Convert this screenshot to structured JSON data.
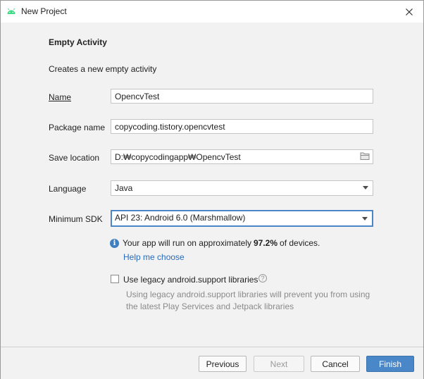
{
  "window": {
    "title": "New Project"
  },
  "content": {
    "heading": "Empty Activity",
    "description": "Creates a new empty activity",
    "fields": {
      "name": {
        "label": "Name",
        "value": "OpencvTest"
      },
      "package": {
        "label": "Package name",
        "value": "copycoding.tistory.opencvtest"
      },
      "save_location": {
        "label": "Save location",
        "value": "D:₩copycodingapp₩OpencvTest"
      },
      "language": {
        "label": "Language",
        "value": "Java"
      },
      "min_sdk": {
        "label": "Minimum SDK",
        "value": "API 23: Android 6.0 (Marshmallow)"
      }
    },
    "info": {
      "prefix": "Your app will run on approximately ",
      "percent": "97.2%",
      "suffix": " of devices."
    },
    "help_link": "Help me choose",
    "legacy": {
      "label": "Use legacy android.support libraries",
      "checked": false,
      "hint_line1": "Using legacy android.support libraries will prevent you from using",
      "hint_line2": "the latest Play Services and Jetpack libraries"
    }
  },
  "footer": {
    "previous": "Previous",
    "next": "Next",
    "cancel": "Cancel",
    "finish": "Finish"
  },
  "colors": {
    "accent": "#4a87c9",
    "android_green": "#3ddc84",
    "link": "#2a6bb8"
  },
  "icons": [
    "android-icon",
    "close-icon",
    "folder-icon",
    "info-icon",
    "help-icon",
    "chevron-down-icon"
  ]
}
